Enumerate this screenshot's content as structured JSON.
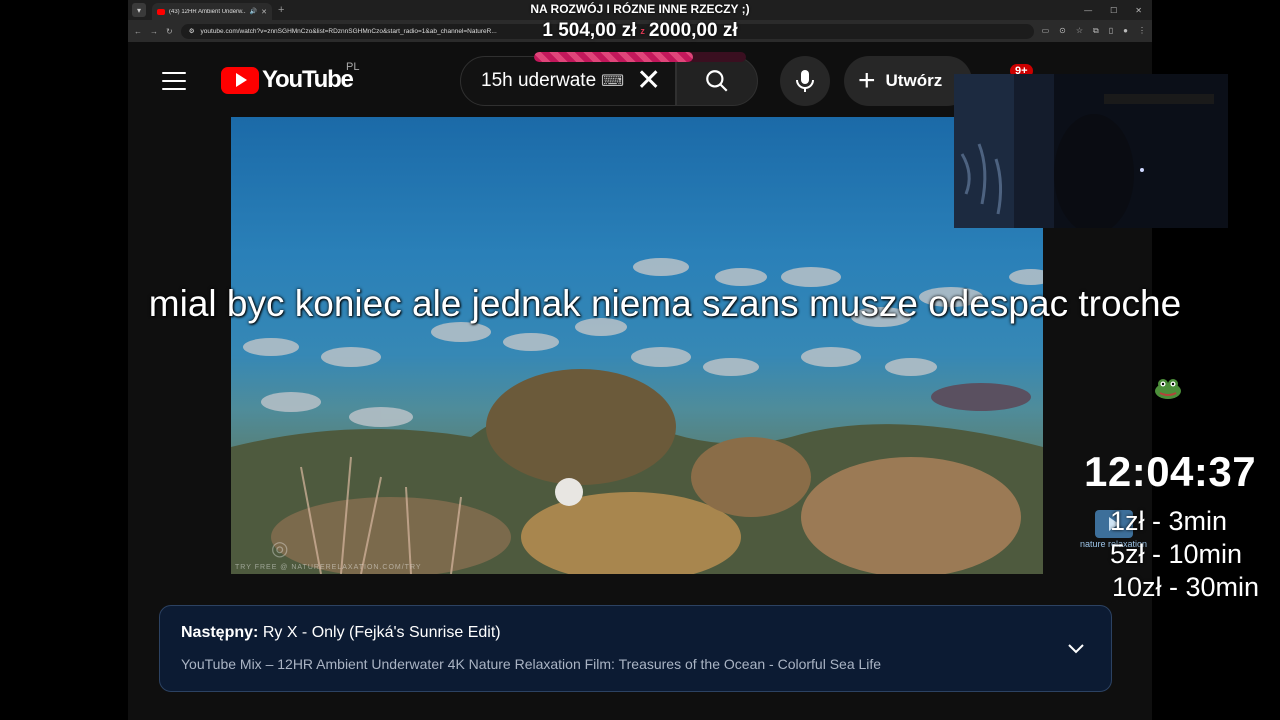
{
  "stream": {
    "goal_title": "NA ROZWÓJ I RÓZNE INNE RZECZY ;)",
    "goal_current": "1 504,00 zł",
    "goal_separator": "z",
    "goal_target": "2000,00 zł",
    "goal_progress": 0.752,
    "caption": "mial byc koniec ale jednak niema szans musze odespac troche",
    "clock": "12:04:37",
    "prices": [
      "1zł - 3min",
      "5zł - 10min",
      "10zł - 30min"
    ],
    "nature_logo_text": "nature relaxation"
  },
  "browser": {
    "tab_title": "(43) 12HR Ambient Underw...",
    "url": "youtube.com/watch?v=znnSGHMnCzo&list=RDznnSGHMnCzo&start_radio=1&ab_channel=NatureR..."
  },
  "youtube": {
    "logo_text": "YouTube",
    "country_code": "PL",
    "search_value": "15h uderwate",
    "create_label": "Utwórz",
    "notif_badge": "9+"
  },
  "player": {
    "watermark": "TRY FREE @ NATURERELAXATION.COM/TRY"
  },
  "next_up": {
    "label": "Następny:",
    "title": "Ry X - Only (Fejká's Sunrise Edit)",
    "mix": "YouTube Mix – 12HR Ambient Underwater 4K Nature Relaxation Film: Treasures of the Ocean - Colorful Sea Life"
  },
  "colors": {
    "yt_red": "#ff0000",
    "goal_bar": "#c2185b",
    "card_bg": "#0c1b33"
  }
}
